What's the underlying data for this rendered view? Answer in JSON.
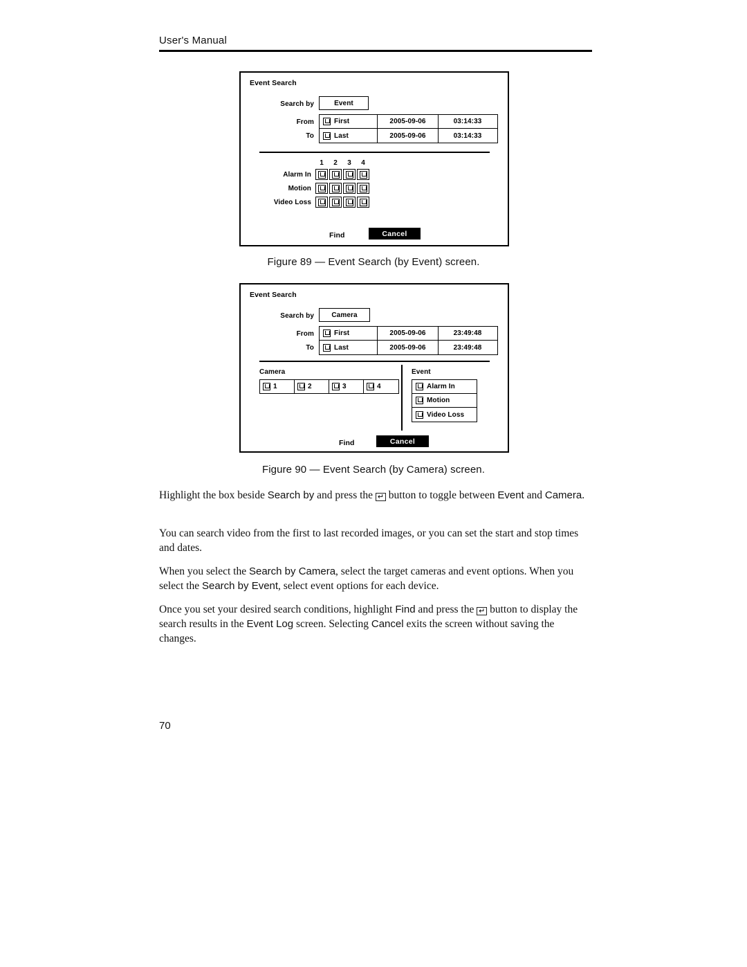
{
  "header": {
    "title": "User's Manual"
  },
  "page_number": "70",
  "figure_89": {
    "caption": "Figure 89 — Event Search (by Event) screen.",
    "dialog": {
      "title": "Event Search",
      "search_by_label": "Search by",
      "search_by_value": "Event",
      "from_label": "From",
      "to_label": "To",
      "from_row": {
        "checkbox_label": "First",
        "checked": true,
        "date": "2005-09-06",
        "time": "03:14:33"
      },
      "to_row": {
        "checkbox_label": "Last",
        "checked": true,
        "date": "2005-09-06",
        "time": "03:14:33"
      },
      "matrix": {
        "columns": [
          "1",
          "2",
          "3",
          "4"
        ],
        "rows": [
          {
            "label": "Alarm In",
            "checked": [
              true,
              true,
              true,
              true
            ]
          },
          {
            "label": "Motion",
            "checked": [
              true,
              true,
              true,
              true
            ]
          },
          {
            "label": "Video Loss",
            "checked": [
              true,
              true,
              true,
              true
            ]
          }
        ]
      },
      "find_label": "Find",
      "cancel_label": "Cancel"
    }
  },
  "figure_90": {
    "caption": "Figure 90 — Event Search (by Camera) screen.",
    "dialog": {
      "title": "Event Search",
      "search_by_label": "Search by",
      "search_by_value": "Camera",
      "from_label": "From",
      "to_label": "To",
      "from_row": {
        "checkbox_label": "First",
        "checked": true,
        "date": "2005-09-06",
        "time": "23:49:48"
      },
      "to_row": {
        "checkbox_label": "Last",
        "checked": true,
        "date": "2005-09-06",
        "time": "23:49:48"
      },
      "camera_panel": {
        "title": "Camera",
        "items": [
          {
            "label": "1",
            "checked": true
          },
          {
            "label": "2",
            "checked": true
          },
          {
            "label": "3",
            "checked": true
          },
          {
            "label": "4",
            "checked": true
          }
        ]
      },
      "event_panel": {
        "title": "Event",
        "items": [
          {
            "label": "Alarm In",
            "checked": true
          },
          {
            "label": "Motion",
            "checked": true
          },
          {
            "label": "Video Loss",
            "checked": true
          }
        ]
      },
      "find_label": "Find",
      "cancel_label": "Cancel"
    }
  },
  "body": {
    "p1": {
      "s1": "Highlight the box beside ",
      "ui1": "Search by",
      "s2": " and press the ",
      "key": "↵",
      "s3": " button to toggle between ",
      "ui2": "Event",
      "s4": " and ",
      "ui3": "Camera",
      "s5": "."
    },
    "p2": {
      "s1": "You can search video from the first to last recorded images, or you can set the start and stop times and dates."
    },
    "p3": {
      "s1": "When you select the ",
      "ui1": "Search by Camera",
      "s2": ", select the target cameras and event options.  When you select the ",
      "ui2": "Search by Event",
      "s3": ", select event options for each device."
    },
    "p4": {
      "s1": "Once you set your desired search conditions, highlight ",
      "ui1": "Find",
      "s2": " and press the ",
      "key": "↵",
      "s3": " button to display the search results in the ",
      "ui2": "Event Log",
      "s4": " screen.  Selecting ",
      "ui3": "Cancel",
      "s5": " exits the screen without saving the changes."
    }
  }
}
